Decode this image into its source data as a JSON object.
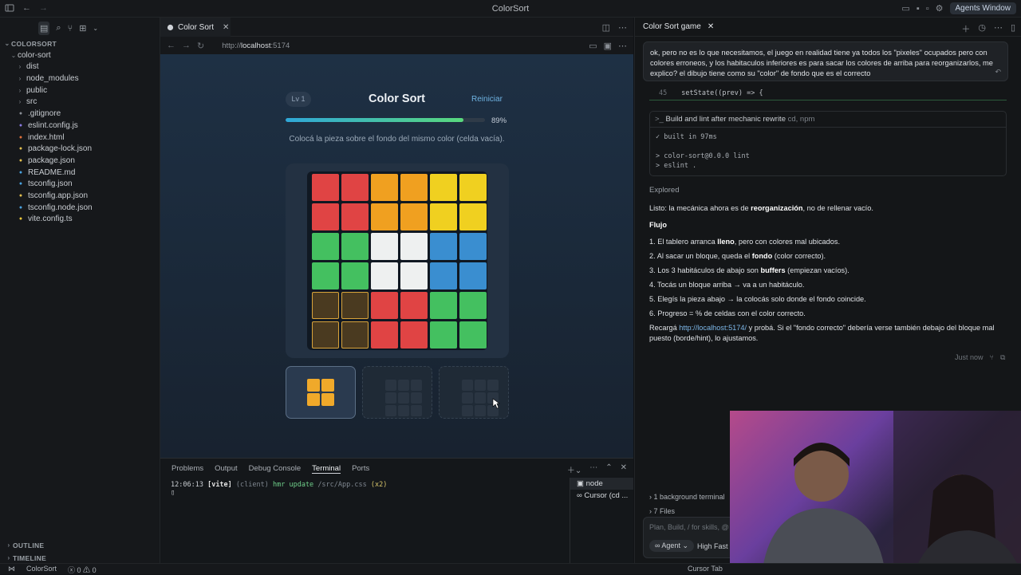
{
  "window": {
    "title": "ColorSort",
    "agents_button": "Agents Window"
  },
  "explorer": {
    "root": "COLORSORT",
    "folder": "color-sort",
    "items": [
      {
        "label": "dist",
        "type": "folder",
        "icon": "chevron-right-icon"
      },
      {
        "label": "node_modules",
        "type": "folder",
        "icon": "chevron-right-icon"
      },
      {
        "label": "public",
        "type": "folder",
        "icon": "chevron-right-icon"
      },
      {
        "label": "src",
        "type": "folder",
        "icon": "chevron-right-icon"
      },
      {
        "label": ".gitignore",
        "type": "file",
        "icon": "git-icon",
        "color": "#8a8f96"
      },
      {
        "label": "eslint.config.js",
        "type": "file",
        "icon": "eslint-icon",
        "color": "#8a7ae0"
      },
      {
        "label": "index.html",
        "type": "file",
        "icon": "html-icon",
        "color": "#e0703a"
      },
      {
        "label": "package-lock.json",
        "type": "file",
        "icon": "json-icon",
        "color": "#e3c04f"
      },
      {
        "label": "package.json",
        "type": "file",
        "icon": "json-icon",
        "color": "#e3c04f"
      },
      {
        "label": "README.md",
        "type": "file",
        "icon": "info-icon",
        "color": "#4aa3e0"
      },
      {
        "label": "tsconfig.json",
        "type": "file",
        "icon": "ts-icon",
        "color": "#4aa3e0"
      },
      {
        "label": "tsconfig.app.json",
        "type": "file",
        "icon": "json-icon",
        "color": "#e3c04f"
      },
      {
        "label": "tsconfig.node.json",
        "type": "file",
        "icon": "ts-icon",
        "color": "#4aa3e0"
      },
      {
        "label": "vite.config.ts",
        "type": "file",
        "icon": "vite-icon",
        "color": "#f0c93a"
      }
    ],
    "outline": "OUTLINE",
    "timeline": "TIMELINE"
  },
  "editor": {
    "tab": "Color Sort",
    "url_prefix": "http://",
    "url_host": "localhost",
    "url_port": ":5174"
  },
  "game": {
    "level": "Lv 1",
    "title": "Color Sort",
    "restart": "Reiniciar",
    "progress": 0.89,
    "progress_label": "89%",
    "instruction": "Colocá la pieza sobre el fondo del mismo color (celda vacía).",
    "colors": {
      "R": "#e04444",
      "O": "#f0a020",
      "Y": "#f0d020",
      "G": "#44c060",
      "W": "#eef0f0",
      "B": "#3a8ed0",
      "E": "#4a3a20"
    },
    "board": [
      [
        "R",
        "R",
        "O",
        "O",
        "Y",
        "Y"
      ],
      [
        "R",
        "R",
        "O",
        "O",
        "Y",
        "Y"
      ],
      [
        "G",
        "G",
        "W",
        "W",
        "B",
        "B"
      ],
      [
        "G",
        "G",
        "W",
        "W",
        "B",
        "B"
      ],
      [
        "E",
        "E",
        "R",
        "R",
        "G",
        "G"
      ],
      [
        "E",
        "E",
        "R",
        "R",
        "G",
        "G"
      ]
    ],
    "slots": [
      {
        "state": "piece",
        "color": "#f0a92a"
      },
      {
        "state": "empty"
      },
      {
        "state": "empty"
      }
    ]
  },
  "panel": {
    "tabs": [
      "Problems",
      "Output",
      "Debug Console",
      "Terminal",
      "Ports"
    ],
    "active_tab": "Terminal",
    "terminal": {
      "time": "12:06:13",
      "tag": "[vite]",
      "client": "(client)",
      "msg": "hmr update",
      "path": "/src/App.css",
      "count": "(x2)"
    },
    "terminals": [
      "node",
      "Cursor (cd ..."
    ]
  },
  "chat": {
    "tab": "Color Sort game",
    "user_message": "ok, pero no es lo que necesitamos, el juego en realidad tiene ya todos los \"pixeles\" ocupados pero con colores erroneos, y los habitaculos inferiores es para sacar los colores de arriba para reorganizarlos, me explico? el dibujo tiene como su \"color\" de fondo que es el correcto",
    "code_line_no": "45",
    "code_line": "setState((prev) => {",
    "cmd_title": "Build and lint after mechanic rewrite",
    "cmd_tools": "cd, npm",
    "cmd_output": [
      "✓ built in 97ms",
      "",
      "> color-sort@0.0.0 lint",
      "> eslint ."
    ],
    "explored": "Explored",
    "reply": {
      "intro_pre": "Listo: la mecánica ahora es de ",
      "intro_bold": "reorganización",
      "intro_post": ", no de rellenar vacío.",
      "heading": "Flujo",
      "steps": [
        {
          "pre": "1. El tablero arranca ",
          "bold": "lleno",
          "post": ", pero con colores mal ubicados."
        },
        {
          "pre": "2. Al sacar un bloque, queda el ",
          "bold": "fondo",
          "post": " (color correcto)."
        },
        {
          "pre": "3. Los 3 habitáculos de abajo son ",
          "bold": "buffers",
          "post": " (empiezan vacíos)."
        },
        {
          "pre": "4. Tocás un bloque arriba → va a un habitáculo.",
          "bold": "",
          "post": ""
        },
        {
          "pre": "5. Elegís la pieza abajo → la colocás solo donde el fondo coincide.",
          "bold": "",
          "post": ""
        },
        {
          "pre": "6. Progreso = % de celdas con el color correcto.",
          "bold": "",
          "post": ""
        }
      ],
      "closing_pre": "Recargá ",
      "closing_link": "http://localhost:5174/",
      "closing_post": " y probá. Si el \"fondo correcto\" debería verse también debajo del bloque mal puesto (borde/hint), lo ajustamos."
    },
    "timestamp": "Just now",
    "bg_terminal": "1 background terminal",
    "files": "7 Files",
    "input_placeholder": "Plan, Build, / for skills, @ for context",
    "agent_mode": "Agent",
    "model": "High Fast"
  },
  "statusbar": {
    "project": "ColorSort",
    "errors": "0",
    "warnings": "0",
    "right": "Cursor Tab"
  }
}
